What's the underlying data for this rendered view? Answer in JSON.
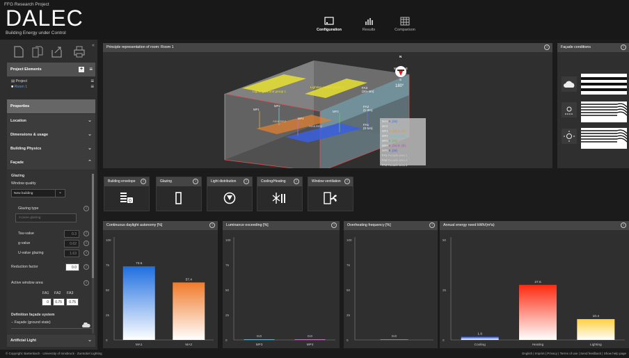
{
  "header": {
    "project_label": "FFG Research Project",
    "logo": "DALEC",
    "subtitle": "Building Energy under Control",
    "nav": [
      {
        "label": "Configuration",
        "icon": "configuration-icon",
        "active": true
      },
      {
        "label": "Results",
        "icon": "results-icon",
        "active": false
      },
      {
        "label": "Comparison",
        "icon": "comparison-icon",
        "active": false
      }
    ]
  },
  "sidebar": {
    "project_elements": {
      "title": "Project Elements",
      "items": [
        "Project",
        "Room 1"
      ]
    },
    "properties_title": "Properties",
    "sections": [
      "Location",
      "Dimensions & usage",
      "Building Physics",
      "Façade"
    ],
    "glazing": {
      "title": "Glazing",
      "window_quality_label": "Window quality",
      "window_quality_value": "New building",
      "glazing_type_label": "Glazing type",
      "glazing_type_placeholder": "2-pane glazing",
      "tau_label": "Tau-value",
      "tau_value": "0.3",
      "g_label": "g-value",
      "g_value": "0.62",
      "u_label": "U-value glazing",
      "u_value": "1.63",
      "reduction_label": "Reduction factor",
      "reduction_value": "0.0",
      "active_window_label": "Active window area",
      "fa_headers": [
        "FA1",
        "FA2",
        "FA3"
      ],
      "fa_values": [
        "0",
        "0.75",
        "0.75"
      ],
      "definition_title": "Definition façade system",
      "facade_state": "Façade (ground state)"
    },
    "artificial_light": "Artificial Light"
  },
  "room_panel": {
    "title": "Principle representation of room: Room 1",
    "compass": {
      "n": "N",
      "e": "E",
      "s": "S",
      "w": "W",
      "angle": "180°"
    },
    "labels": {
      "lcg1": "Lighting control group 1",
      "lcg2": "Lighting control group 2",
      "fa3": "FA3",
      "fa3_h": "(2m-4m)",
      "fa2": "FA2",
      "fa2_h": "(1-2m)",
      "fa1": "FA1",
      "fa1_h": "(0-1m)",
      "ma2": "Area MA2",
      "ma1": "Area MA1",
      "mp1": "MP1",
      "mp2": "MP2",
      "mp3": "MP3",
      "mp4": "MP4"
    },
    "legend": [
      {
        "k": "MA1",
        "v": "E_{in}",
        "color": "#4f7ff0"
      },
      {
        "k": "MA2",
        "v": "",
        "color": "#e0a050"
      },
      {
        "k": "MP1",
        "v": "E_{in} E_{h}",
        "color": "#d9b050"
      },
      {
        "k": "MP2",
        "v": "E_{in} E_{h}",
        "color": "#7fd0d0"
      },
      {
        "k": "MP3",
        "v": "E_{in}",
        "color": "#70c070"
      },
      {
        "k": "MP4",
        "v": "E_{in} E_{h}",
        "color": "#c070c0"
      },
      {
        "k": "MP5",
        "v": "E_{in}",
        "color": "#7070e0"
      },
      {
        "k": "FA1",
        "v": "Facade area 1",
        "color": "#dddddd"
      },
      {
        "k": "FA2",
        "v": "Facade area 2",
        "color": "#dddddd"
      },
      {
        "k": "FA3",
        "v": "Facade area 3",
        "color": "#dddddd"
      }
    ]
  },
  "facade_panel": {
    "title": "Façade conditions"
  },
  "tiles": [
    {
      "label": "Building envelope",
      "icon": "building-envelope-icon"
    },
    {
      "label": "Glazing",
      "icon": "glazing-icon"
    },
    {
      "label": "Light distribution",
      "icon": "light-distribution-icon"
    },
    {
      "label": "Cooling/Heating",
      "icon": "cooling-heating-icon"
    },
    {
      "label": "Window ventilation",
      "icon": "window-ventilation-icon"
    }
  ],
  "chart_data": [
    {
      "type": "bar",
      "title": "Continuous daylight autonomy [%]",
      "categories": [
        "MA1",
        "MA2"
      ],
      "values": [
        73.5,
        57.4
      ],
      "ylim": [
        0,
        100
      ],
      "yticks": [
        "0",
        "25",
        "50",
        "75",
        "100"
      ],
      "colors": [
        "#1f6fe0",
        "#f07b2a"
      ]
    },
    {
      "type": "bar",
      "title": "Luminance exceeding [%]",
      "categories": [
        "MP3",
        "MP4"
      ],
      "values": [
        0.0,
        0.0
      ],
      "labels": [
        "0.0",
        "0.0"
      ],
      "ylim": [
        0,
        100
      ],
      "yticks": [
        "0",
        "25",
        "50",
        "75",
        "100"
      ],
      "colors": [
        "#5fb0d0",
        "#c070c0"
      ]
    },
    {
      "type": "bar",
      "title": "Overheating frequency [%]",
      "categories": [
        ""
      ],
      "values": [
        0.0
      ],
      "labels": [
        "0.0"
      ],
      "ylim": [
        0,
        100
      ],
      "yticks": [
        "0",
        "25",
        "50",
        "75",
        "100"
      ],
      "colors": [
        "#888888"
      ]
    },
    {
      "type": "bar",
      "title": "Annual energy need kWh/(m²a)",
      "categories": [
        "Cooling",
        "Heating",
        "Lighting"
      ],
      "values": [
        1.6,
        27.5,
        10.4
      ],
      "ylim": [
        0,
        50
      ],
      "yticks": [
        "0",
        "25",
        "50"
      ],
      "colors": [
        "#1f4fe0",
        "#ff2a10",
        "#ffd040"
      ]
    }
  ],
  "footer": {
    "left": "© Copyright: Bartenbach · University of Innsbruck · Zumtobel Lighting",
    "right": "English | Imprint | Privacy | Terms of use | Send feedback | Show help page"
  }
}
